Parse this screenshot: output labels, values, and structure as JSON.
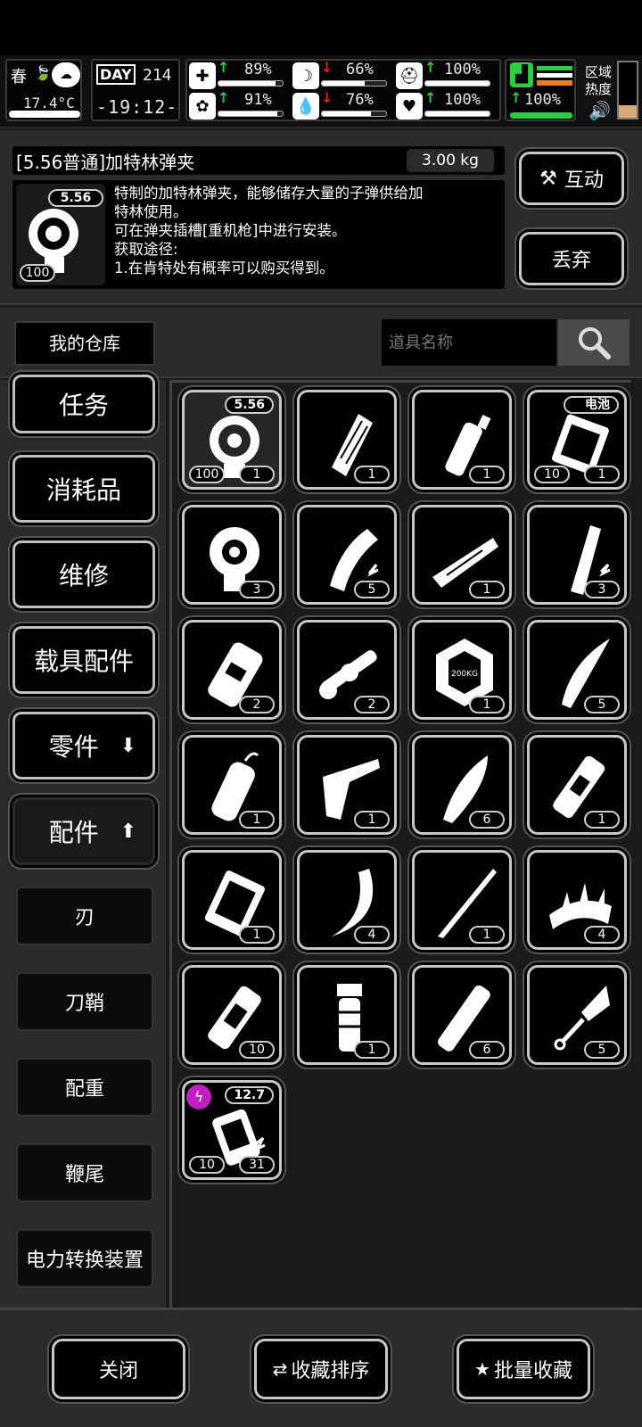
{
  "status": {
    "season": "春",
    "temperature": "17.4°C",
    "day_label": "DAY",
    "day_number": "214",
    "time": "-19:12-",
    "stats": [
      {
        "name": "health",
        "icon": "medkit-icon",
        "trend": "up",
        "value": "89%",
        "level": 0.89
      },
      {
        "name": "hunger",
        "icon": "stomach-icon",
        "trend": "down",
        "value": "66%",
        "level": 0.66
      },
      {
        "name": "armor",
        "icon": "helmet-icon",
        "trend": "up",
        "value": "100%",
        "level": 1.0
      },
      {
        "name": "mental",
        "icon": "brain-icon",
        "trend": "up",
        "value": "91%",
        "level": 0.91
      },
      {
        "name": "thirst",
        "icon": "water-drop-icon",
        "trend": "down",
        "value": "76%",
        "level": 0.76
      },
      {
        "name": "mood",
        "icon": "heart-icon",
        "trend": "up",
        "value": "100%",
        "level": 1.0
      }
    ],
    "stamina": {
      "trend": "up",
      "value": "100%",
      "level": 1.0
    },
    "zone_heat_label": "区域\n热度"
  },
  "detail": {
    "item_title": "[5.56普通]加特林弹夹",
    "weight": "3.00 kg",
    "icon_tag": "5.56",
    "icon_count": "100",
    "description_lines": [
      "特制的加特林弹夹，能够储存大量的子弹供给加",
      "特林使用。",
      "可在弹夹插槽[重机枪]中进行安装。",
      "获取途径:",
      "1.在肯特处有概率可以购买得到。"
    ],
    "interact_label": "互动",
    "discard_label": "丢弃"
  },
  "search": {
    "warehouse_label": "我的仓库",
    "placeholder": "道具名称"
  },
  "sidebar": {
    "categories": [
      "任务",
      "消耗品",
      "维修",
      "载具配件",
      "零件",
      "配件"
    ],
    "subcategories": [
      "刃",
      "刀鞘",
      "配重",
      "鞭尾",
      "电力转换装置"
    ]
  },
  "items": [
    {
      "icon": "gatling-magazine-icon",
      "tag": "5.56",
      "left_count": "100",
      "count": "1",
      "selected": true
    },
    {
      "icon": "belt-magazine-icon",
      "count": "1"
    },
    {
      "icon": "spray-can-icon",
      "count": "1"
    },
    {
      "icon": "battery-pack-icon",
      "tag": "电池",
      "left_count": "10",
      "count": "1"
    },
    {
      "icon": "drum-magazine-icon",
      "count": "3"
    },
    {
      "icon": "curved-magazine-icon",
      "count": "5"
    },
    {
      "icon": "wood-plank-icon",
      "count": "1"
    },
    {
      "icon": "pistol-magazine-icon",
      "count": "3"
    },
    {
      "icon": "fuel-canister-icon",
      "count": "2"
    },
    {
      "icon": "rifle-scope-icon",
      "count": "2"
    },
    {
      "icon": "weight-plate-icon",
      "count": "1"
    },
    {
      "icon": "curved-blade-icon",
      "count": "5"
    },
    {
      "icon": "gas-cylinder-icon",
      "count": "1"
    },
    {
      "icon": "rifle-stock-icon",
      "count": "1"
    },
    {
      "icon": "machete-blade-icon",
      "count": "6"
    },
    {
      "icon": "grip-handle-icon",
      "count": "1"
    },
    {
      "icon": "battery-cell-icon",
      "count": "1"
    },
    {
      "icon": "crescent-blade-icon",
      "count": "4"
    },
    {
      "icon": "katana-blade-icon",
      "count": "1"
    },
    {
      "icon": "spiked-band-icon",
      "count": "4"
    },
    {
      "icon": "handle-wrap-icon",
      "count": "10"
    },
    {
      "icon": "pommel-grip-icon",
      "count": "1"
    },
    {
      "icon": "tube-handle-icon",
      "count": "6"
    },
    {
      "icon": "spear-tip-icon",
      "count": "5"
    },
    {
      "icon": "electric-magazine-icon",
      "tag": "12.7",
      "left_count": "10",
      "count": "31"
    }
  ],
  "bottom": {
    "close_label": "关闭",
    "sort_label": "收藏排序",
    "batch_label": "批量收藏"
  }
}
